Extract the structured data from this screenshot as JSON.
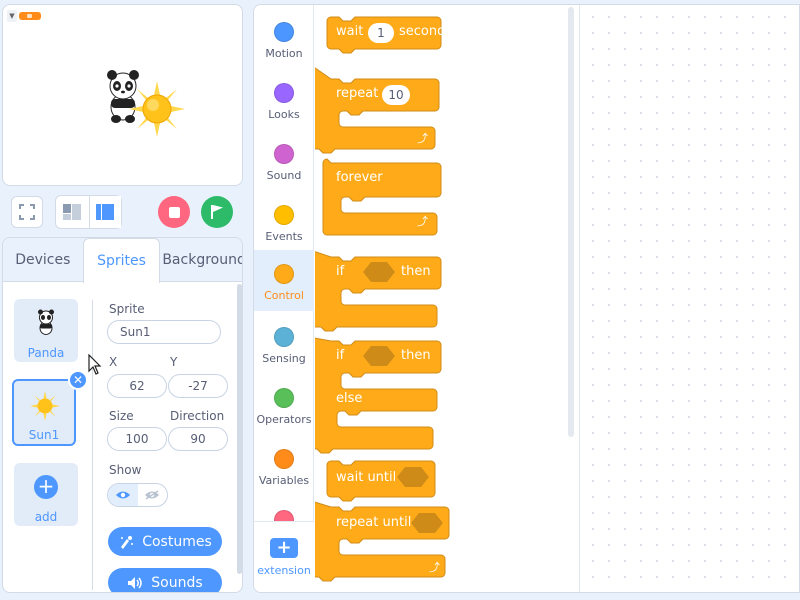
{
  "stage": {
    "sprites_shown": [
      "panda",
      "sun"
    ]
  },
  "tabs": [
    {
      "label": "Devices"
    },
    {
      "label": "Sprites"
    },
    {
      "label": "Background"
    }
  ],
  "sprites": [
    {
      "name": "Panda"
    },
    {
      "name": "Sun1"
    }
  ],
  "add_label": "add",
  "sprite_info": {
    "sprite_label": "Sprite",
    "sprite_name": "Sun1",
    "x_label": "X",
    "x_value": "62",
    "y_label": "Y",
    "y_value": "-27",
    "size_label": "Size",
    "size_value": "100",
    "direction_label": "Direction",
    "direction_value": "90",
    "show_label": "Show"
  },
  "buttons": {
    "costumes": "Costumes",
    "sounds": "Sounds"
  },
  "categories": [
    {
      "label": "Motion",
      "color": "#4c97ff"
    },
    {
      "label": "Looks",
      "color": "#9966ff"
    },
    {
      "label": "Sound",
      "color": "#cf63cf"
    },
    {
      "label": "Events",
      "color": "#ffbf00"
    },
    {
      "label": "Control",
      "color": "#ffab19"
    },
    {
      "label": "Sensing",
      "color": "#5cb1d6"
    },
    {
      "label": "Operators",
      "color": "#59c059"
    },
    {
      "label": "Variables",
      "color": "#ff8c1a"
    }
  ],
  "extension_label": "extension",
  "blocks": {
    "wait": {
      "label": "wait",
      "value": "1",
      "unit": "seconds"
    },
    "repeat": {
      "label": "repeat",
      "value": "10"
    },
    "forever": {
      "label": "forever"
    },
    "if_then": {
      "if": "if",
      "then": "then"
    },
    "if_else": {
      "if": "if",
      "then": "then",
      "else": "else"
    },
    "wait_until": {
      "label": "wait until"
    },
    "repeat_until": {
      "label": "repeat until"
    }
  },
  "colors": {
    "control": "#ffab19",
    "control_dark": "#cf8b17",
    "accent": "#4d97ff",
    "stop": "#ff6680",
    "go": "#2dbb6a"
  }
}
